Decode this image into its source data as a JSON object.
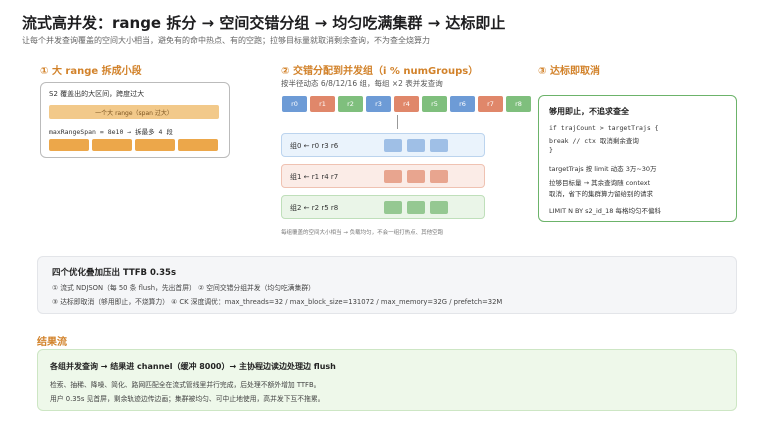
{
  "header": {
    "title": "流式高并发：range 拆分 → 空间交错分组 → 均匀吃满集群 → 达标即止",
    "subtitle": "让每个并发查询覆盖的空间大小相当，避免有的命中热点、有的空跑；拉够目标量就取消剩余查询，不为查全烧算力"
  },
  "section1": {
    "heading": "① 大 range 拆成小段",
    "panel_title": "S2 覆盖出的大区间，跨度过大",
    "bar_label": "一个大 range（span 过大）",
    "code": "maxRangeSpan = 8e10 → 拆最多 4 段"
  },
  "section2": {
    "heading": "② 交错分配到并发组（i % numGroups）",
    "note": "按半径动态 6/8/12/16 组，每组 ×2 表并发查询",
    "slots": [
      "r0",
      "r1",
      "r2",
      "r3",
      "r4",
      "r5",
      "r6",
      "r7",
      "r8"
    ],
    "groups": [
      {
        "label": "组0 ← r0 r3 r6"
      },
      {
        "label": "组1 ← r1 r4 r7"
      },
      {
        "label": "组2 ← r2 r5 r8"
      }
    ],
    "footnote": "每组覆盖的空间大小相当 → 负载均匀，不会一组打热点、其他空跑"
  },
  "section3": {
    "heading": "③ 达标即取消",
    "panel_heading": "够用即止，不追求查全",
    "code_line1": "if trajCount > targetTrajs {",
    "code_line2": "  break // ctx 取消剩余查询",
    "code_line3": "}",
    "line4": "targetTrajs 按 limit 动态 3万~30万",
    "line5": "拉够目标量 → 其余查询随 context",
    "line6": "取消，省下的集群算力留给别的请求",
    "line7": "LIMIT N BY s2_id_18 每格均匀不偏科"
  },
  "summary": {
    "heading": "四个优化叠加压出 TTFB 0.35s",
    "line1": "① 流式 NDJSON（每 50 条 flush，先出首屏）   ② 空间交错分组并发（均匀吃满集群）",
    "line2": "③ 达标即取消（够用即止，不烧算力）   ④ CK 深度调优：max_threads=32 / max_block_size=131072 / max_memory=32G / prefetch=32M"
  },
  "result_flow": {
    "heading": "结果流",
    "bold_line": "各组并发查询 → 结果进 channel（缓冲 8000）→ 主协程边读边处理边 flush",
    "line1": "检索、抽稀、降噪、简化、路网匹配全在流式管线里并行完成，后处理不额外增加 TTFB。",
    "line2": "用户 0.35s 见首屏，剩余轨迹边传边画；集群被均匀、可中止地使用，高并发下互不拖累。"
  },
  "colors": {
    "accent_orange": "#d2822a",
    "segment_orange": "#eca74a",
    "blue": "#6d9bd6",
    "salmon": "#e0876a",
    "green": "#7fbf7d",
    "group_blue_bg": "#eaf3fc",
    "group_salmon_bg": "#fbece7",
    "group_green_bg": "#eaf5e8"
  }
}
